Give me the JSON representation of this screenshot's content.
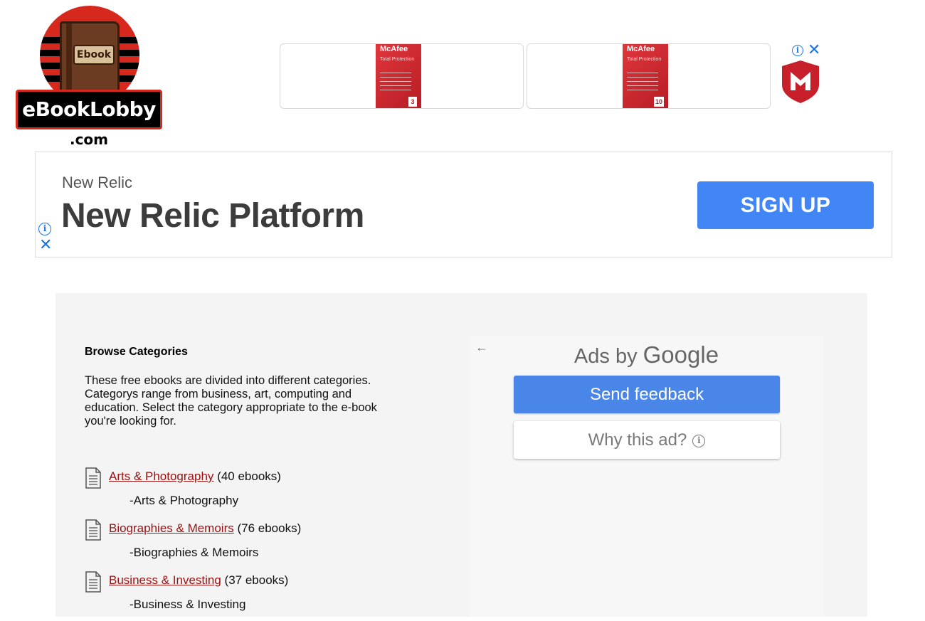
{
  "logo": {
    "book_label": "Ebook",
    "name": "eBookLobby",
    "tld": ".com"
  },
  "top_ad": {
    "products": [
      {
        "brand": "McAfee",
        "product": "Total Protection",
        "devices": "3"
      },
      {
        "brand": "McAfee",
        "product": "Total Protection",
        "devices": "10"
      }
    ],
    "info_icon": "ⓘ",
    "close_icon": "✕"
  },
  "newrelic_ad": {
    "advertiser": "New Relic",
    "headline": "New Relic Platform",
    "button_label": "SIGN UP",
    "info_icon": "ⓘ",
    "close_icon": "✕"
  },
  "browse": {
    "title": "Browse Categories",
    "description": "These free ebooks are divided into different categories. Categorys range from business, art, computing and education. Select the category appropriate to the e-book you're looking for.",
    "categories": [
      {
        "name": "Arts & Photography",
        "count": "(40 ebooks)",
        "sub": "-Arts & Photography"
      },
      {
        "name": "Biographies & Memoirs",
        "count": "(76 ebooks)",
        "sub": "-Biographies & Memoirs"
      },
      {
        "name": "Business & Investing",
        "count": "(37 ebooks)",
        "sub": "-Business & Investing"
      }
    ]
  },
  "google_panel": {
    "back_icon": "←",
    "heading_prefix": "Ads by ",
    "heading_brand": "Google",
    "feedback_label": "Send feedback",
    "why_label": "Why this ad?",
    "why_icon": "i"
  },
  "colors": {
    "link": "#a01010",
    "google_blue": "#4285f4",
    "ad_info_blue": "#1a73e8",
    "logo_red": "#d7281e",
    "panel_bg": "#f4f4f4"
  }
}
